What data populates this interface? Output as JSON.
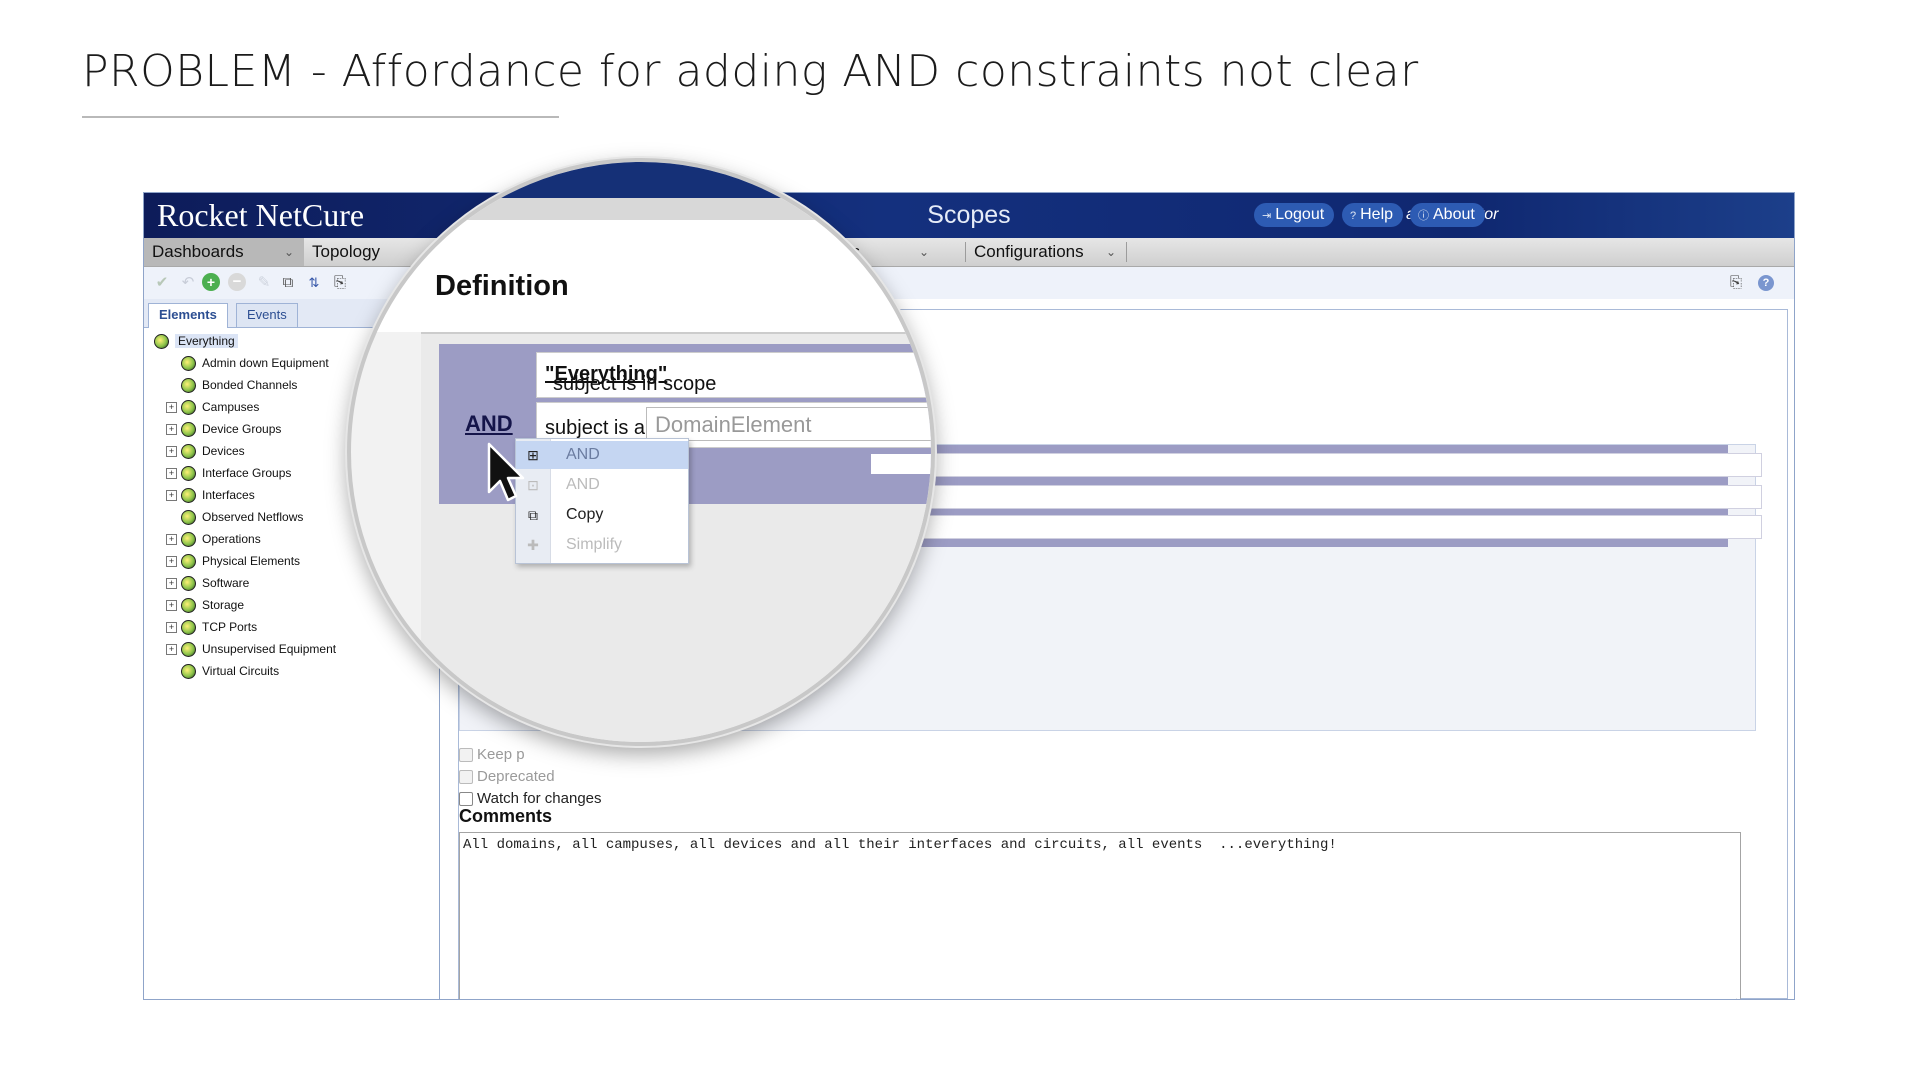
{
  "slide": {
    "title": "PROBLEM - Affordance for adding AND constraints not clear"
  },
  "app": {
    "brand": "Rocket NetCure",
    "page_name": "Scopes",
    "user": "administrator",
    "header_buttons": {
      "logout": "Logout",
      "help": "Help",
      "about": "About"
    },
    "menu": {
      "dashboards": "Dashboards",
      "topology": "Topology",
      "operations_partial": "ns",
      "configurations": "Configurations"
    },
    "tabs": {
      "elements": "Elements",
      "events": "Events"
    },
    "tree": [
      {
        "label": "Everything",
        "expandable": false,
        "root": true
      },
      {
        "label": "Admin down Equipment",
        "expandable": false
      },
      {
        "label": "Bonded Channels",
        "expandable": false
      },
      {
        "label": "Campuses",
        "expandable": true
      },
      {
        "label": "Device Groups",
        "expandable": true
      },
      {
        "label": "Devices",
        "expandable": true
      },
      {
        "label": "Interface Groups",
        "expandable": true
      },
      {
        "label": "Interfaces",
        "expandable": true
      },
      {
        "label": "Observed Netflows",
        "expandable": false
      },
      {
        "label": "Operations",
        "expandable": true
      },
      {
        "label": "Physical Elements",
        "expandable": true
      },
      {
        "label": "Software",
        "expandable": true
      },
      {
        "label": "Storage",
        "expandable": true
      },
      {
        "label": "TCP Ports",
        "expandable": true
      },
      {
        "label": "Unsupervised Equipment",
        "expandable": true
      },
      {
        "label": "Virtual Circuits",
        "expandable": false
      }
    ],
    "definition": {
      "heading": "Definition",
      "operator": "AND",
      "constraint1_prefix": "subject is in scope",
      "constraint1_value": "\"Everything\"",
      "constraint2_prefix": "subject is a",
      "constraint2_placeholder": "DomainElement"
    },
    "context_menu": {
      "and_1": "AND",
      "and_2": "AND",
      "copy": "Copy",
      "simplify": "Simplify"
    },
    "checkboxes": {
      "keep": "Keep p",
      "deprecated": "Deprecated",
      "watch": "Watch for changes"
    },
    "comments_label": "Comments",
    "comments_text": "All domains, all campuses, all devices and all their interfaces and circuits, all events  ...everything!"
  }
}
